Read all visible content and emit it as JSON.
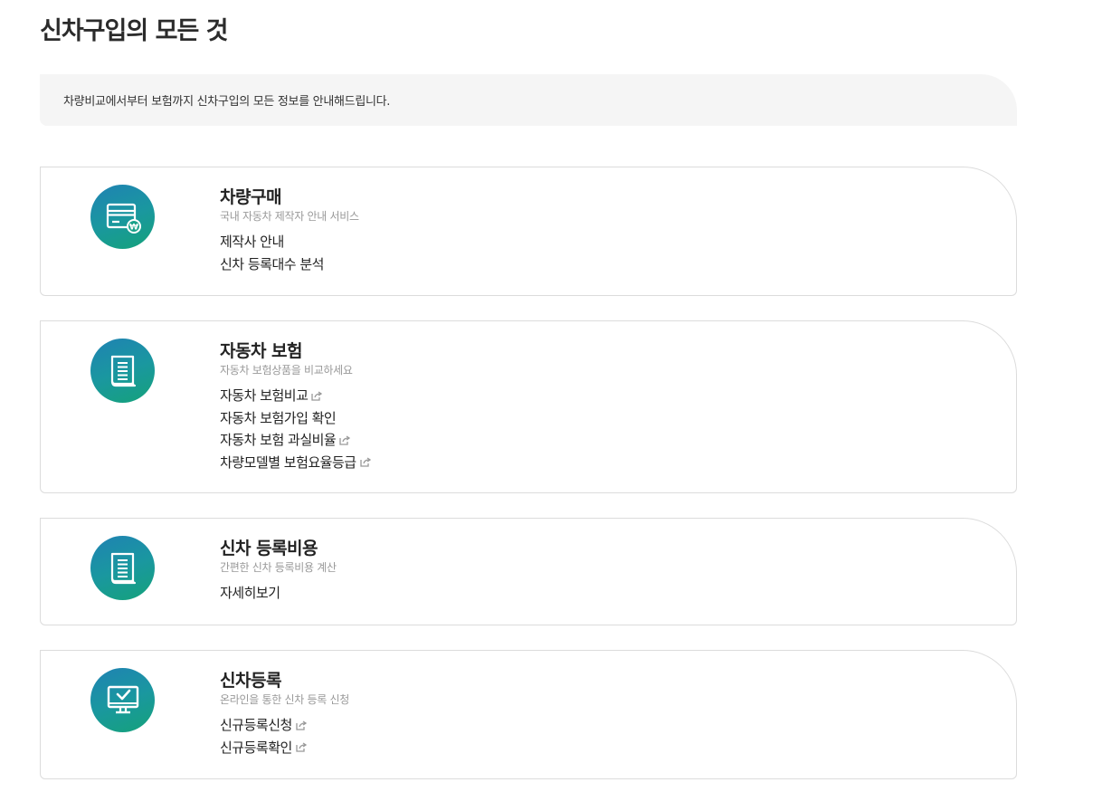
{
  "page": {
    "title": "신차구입의 모든 것",
    "intro": "차량비교에서부터 보험까지 신차구입의 모든 정보를 안내해드립니다."
  },
  "cards": [
    {
      "icon": "card-payment-icon",
      "title": "차량구매",
      "subtitle": "국내 자동차 제작자 안내 서비스",
      "links": [
        {
          "label": "제작사 안내",
          "external": false
        },
        {
          "label": "신차 등록대수 분석",
          "external": false
        }
      ]
    },
    {
      "icon": "document-icon",
      "title": "자동차 보험",
      "subtitle": "자동차 보험상품을 비교하세요",
      "links": [
        {
          "label": "자동차 보험비교",
          "external": true
        },
        {
          "label": "자동차 보험가입 확인",
          "external": false
        },
        {
          "label": "자동차 보험 과실비율",
          "external": true
        },
        {
          "label": "차량모델별 보험요율등급",
          "external": true
        }
      ]
    },
    {
      "icon": "document-icon",
      "title": "신차 등록비용",
      "subtitle": "간편한 신차 등록비용 계산",
      "links": [
        {
          "label": "자세히보기",
          "external": false
        }
      ]
    },
    {
      "icon": "monitor-check-icon",
      "title": "신차등록",
      "subtitle": "온라인을 통한 신차 등록 신청",
      "links": [
        {
          "label": "신규등록신청",
          "external": true
        },
        {
          "label": "신규등록확인",
          "external": true
        }
      ]
    }
  ],
  "colors": {
    "icon_gradient_start": "#1f82b3",
    "icon_gradient_end": "#15a27a",
    "intro_bg": "#f5f5f5",
    "card_border": "#dcdcdc"
  }
}
